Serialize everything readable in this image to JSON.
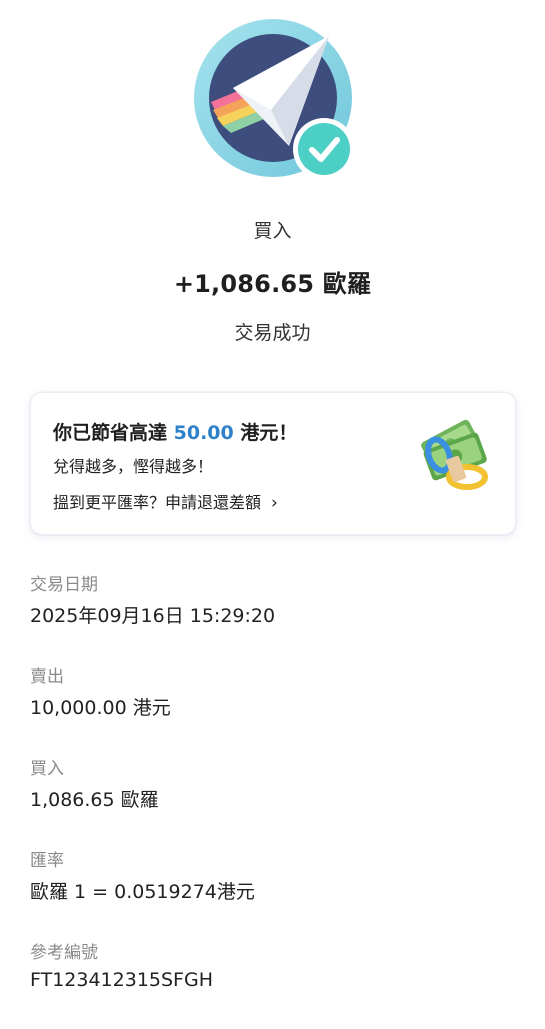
{
  "header": {
    "icon": "paper-plane-success-icon",
    "type": "買入",
    "amount": "+1,086.65 歐羅",
    "status": "交易成功"
  },
  "promo": {
    "title_prefix": "你已節省高達 ",
    "title_amount": "50.00",
    "title_suffix": " 港元！",
    "subtitle": "兌得越多，慳得越多！",
    "link_text": "搵到更平匯率？申請退還差額",
    "link_chevron": "›",
    "icon": "money-stack-icon",
    "highlight_color": "#2f82c9"
  },
  "details": [
    {
      "label": "交易日期",
      "value": "2025年09月16日 15:29:20"
    },
    {
      "label": "賣出",
      "value": "10,000.00 港元"
    },
    {
      "label": "買入",
      "value": "1,086.65 歐羅"
    },
    {
      "label": "匯率",
      "value": "歐羅 1 = 0.0519274港元"
    },
    {
      "label": "參考編號",
      "value": "FT123412315SFGH"
    }
  ],
  "colors": {
    "icon_ring": "#8dd8e6",
    "icon_core": "#3d4d7e",
    "check_badge": "#4ccfc4"
  }
}
